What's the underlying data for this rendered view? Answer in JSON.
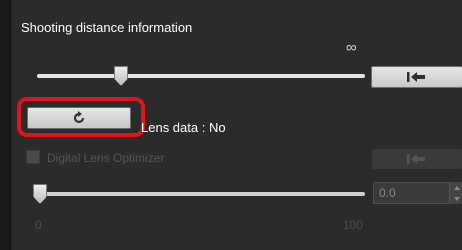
{
  "section": {
    "title": "Shooting distance information",
    "infinity_symbol": "∞",
    "distance_slider_level_fraction": 0.25
  },
  "lens": {
    "label": "Lens data : No",
    "refresh_icon": "refresh-icon",
    "highlight_color": "#e3131c"
  },
  "dlo": {
    "checkbox_label": "Digital Lens Optimizer",
    "value": "0.0",
    "slider_min": "0",
    "slider_max": "100",
    "slider_value": 0
  },
  "icons": {
    "reset_icon": "reset-to-start-icon"
  }
}
